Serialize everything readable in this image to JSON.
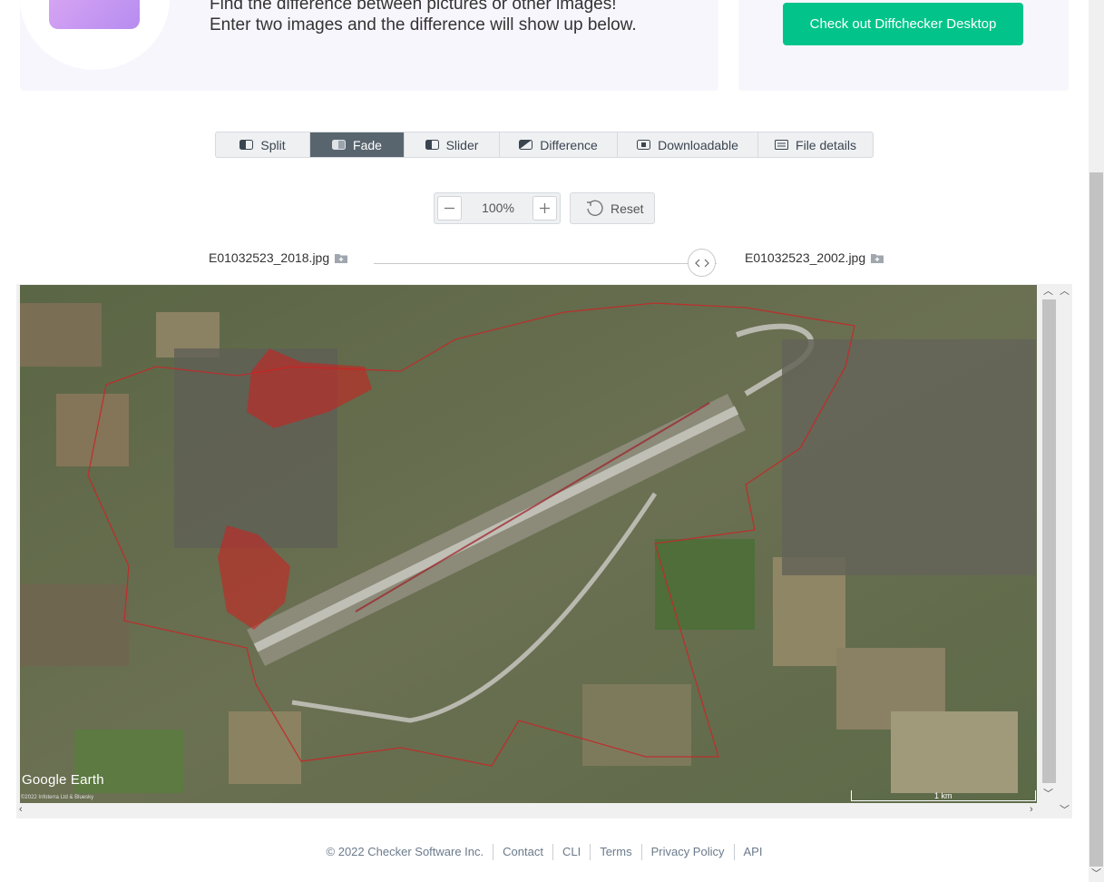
{
  "hero": {
    "line1": "Find the difference between pictures or other images!",
    "line2": "Enter two images and the difference will show up below.",
    "cta_label": "Check out Diffchecker Desktop",
    "accent": "#02c48a"
  },
  "tabs": [
    {
      "label": "Split",
      "icon": "split-icon"
    },
    {
      "label": "Fade",
      "icon": "fade-icon",
      "active": true
    },
    {
      "label": "Slider",
      "icon": "slider-icon"
    },
    {
      "label": "Difference",
      "icon": "difference-icon"
    },
    {
      "label": "Downloadable",
      "icon": "download-icon"
    },
    {
      "label": "File details",
      "icon": "file-details-icon"
    }
  ],
  "zoom": {
    "value": "100%",
    "reset_label": "Reset"
  },
  "files": {
    "left": "E01032523_2018.jpg",
    "right": "E01032523_2002.jpg"
  },
  "map": {
    "logo": "Google Earth",
    "credit": "©2022 Infoterra Ltd & Bluesky",
    "scale": "1 km"
  },
  "footer": {
    "copyright": "© 2022 Checker Software Inc.",
    "links": [
      "Contact",
      "CLI",
      "Terms",
      "Privacy Policy",
      "API"
    ]
  }
}
